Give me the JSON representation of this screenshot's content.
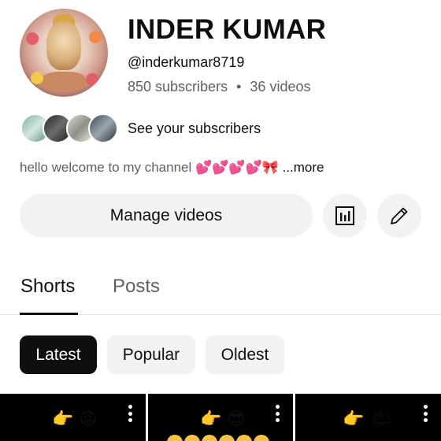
{
  "channel": {
    "name": "INDER KUMAR",
    "handle": "@inderkumar8719",
    "subscribers": "850 subscribers",
    "separator": "•",
    "videos": "36 videos",
    "avatar_icon": "ganesha-avatar"
  },
  "subscribers_row": {
    "label": "See your subscribers"
  },
  "bio": {
    "text": "hello welcome to my channel",
    "emojis": "💕💕💕💕🎀",
    "more": "...more"
  },
  "actions": {
    "manage_label": "Manage videos",
    "analytics_icon": "analytics-icon",
    "edit_icon": "pencil-icon"
  },
  "tabs": [
    {
      "label": "Shorts",
      "active": true
    },
    {
      "label": "Posts",
      "active": false
    }
  ],
  "filters": [
    {
      "label": "Latest",
      "active": true
    },
    {
      "label": "Popular",
      "active": false
    },
    {
      "label": "Oldest",
      "active": false
    }
  ],
  "shorts": [
    {
      "emojis": "👉 😡"
    },
    {
      "emojis": "👉 😎"
    },
    {
      "emojis": "👉 🌤"
    }
  ],
  "colors": {
    "accent": "#0f0f0f",
    "secondary_text": "#606060",
    "button_bg": "#f2f2f2"
  }
}
